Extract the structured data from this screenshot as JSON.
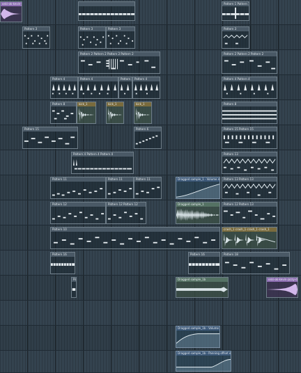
{
  "playlist": {
    "clips": {
      "audio_vocal": "oski-ok-kevin-jazzy-drums_1",
      "p_top": "",
      "p_top_right": "Pattern 1  Pattern 1",
      "p3_left": "Pattern 3",
      "p3_mid": "Pattern 3",
      "p3_right": "Pattern 3",
      "p2_left": "Pattern 2  Pattern 2  Pattern 2  Pattern 2",
      "p2_right": "Pattern 2  Pattern 2  Pattern 2",
      "p4_a": "Pattern 4",
      "p4_b": "Pattern 4",
      "p4_c": "Pattern 4",
      "p4_d": "Pattern 4",
      "p4_right": "Pattern 4  Pattern 4",
      "p_kick_a": "Pattern 8",
      "p_kick_b": "kick_1",
      "p_kick_c": "kick_1",
      "p_kick_d": "kick_1",
      "p_row5_right": "Pattern 8",
      "p5_left": "Pattern 15",
      "p5_mid": "Pattern 6",
      "p5_right": "Pattern 15  Pattern 15",
      "p6_mid": "Pattern 4   Pattern 4   Pattern 4",
      "p6_right": "Pattern 13",
      "p7_left": "Pattern 11",
      "p7_mid": "Pattern 11",
      "p7_right": "Pattern 11",
      "auto_a": "Dragged sample_1 - Volume multiplier envelope",
      "p7_far": "Pattern 13   Pattern 13",
      "p8_left": "Pattern 12",
      "p8_mid": "Pattern 12   Pattern 12",
      "p8_audio": "Dragged sample_1",
      "p8_right": "Pattern 12   Pattern 13",
      "p9_left": "Pattern 10",
      "p9_right": "crash_1  crash_1  crash_1  crash_1",
      "p10_left": "Pattern 16",
      "p10_right": "Pattern 18",
      "p11_audio": "Dragged sample_1b",
      "p11_pink": "oski-ok-kevin-jazzy-drums_2",
      "auto_b": "Dragged sample_1b - Volume multiplier envelope",
      "auto_c": "Dragged sample_1b - Panning offset envelope"
    }
  },
  "colors": {
    "grid_bg": "#34434f",
    "clip_header": "#4a5966",
    "note": "#e8eef2",
    "audio_header": "#557264",
    "vocal_clip": "#8e6fb3",
    "automation_header": "#3c5878"
  }
}
